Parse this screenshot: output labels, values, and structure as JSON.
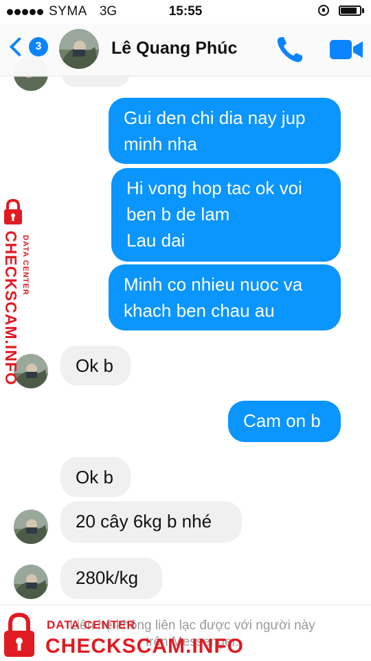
{
  "status_bar": {
    "carrier": "SYMA",
    "network": "3G",
    "time": "15:55",
    "battery_level": 0.85
  },
  "header": {
    "back_badge_count": "3",
    "contact_name": "Lê Quang Phúc"
  },
  "messages": [
    {
      "direction": "outgoing",
      "lines": [
        "Gui den chi dia nay jup",
        "minh nha"
      ]
    },
    {
      "direction": "outgoing",
      "lines": [
        "Hi vong hop tac ok voi",
        "ben b de lam",
        "Lau dai"
      ]
    },
    {
      "direction": "outgoing",
      "lines": [
        "Minh co nhieu nuoc va",
        "khach ben chau au"
      ]
    },
    {
      "direction": "incoming",
      "lines": [
        "Ok b"
      ]
    },
    {
      "direction": "outgoing",
      "lines": [
        "Cam on b"
      ]
    },
    {
      "direction": "incoming",
      "lines": [
        "Ok b"
      ]
    },
    {
      "direction": "incoming",
      "lines": [
        "20 cây 6kg b nhé"
      ]
    },
    {
      "direction": "incoming",
      "lines": [
        "280k/kg"
      ]
    }
  ],
  "notice": {
    "line1": "Liên hệ không liên lạc được với người này",
    "line2": "trên Messenger."
  },
  "watermark": {
    "tag": "DATA CENTER",
    "brand": "CHECKSCAM.INFO"
  },
  "colors": {
    "accent": "#0a84ff",
    "outgoing_bubble": "#0a95ff",
    "incoming_bubble": "#f1f0f0",
    "watermark": "#e01b22"
  }
}
